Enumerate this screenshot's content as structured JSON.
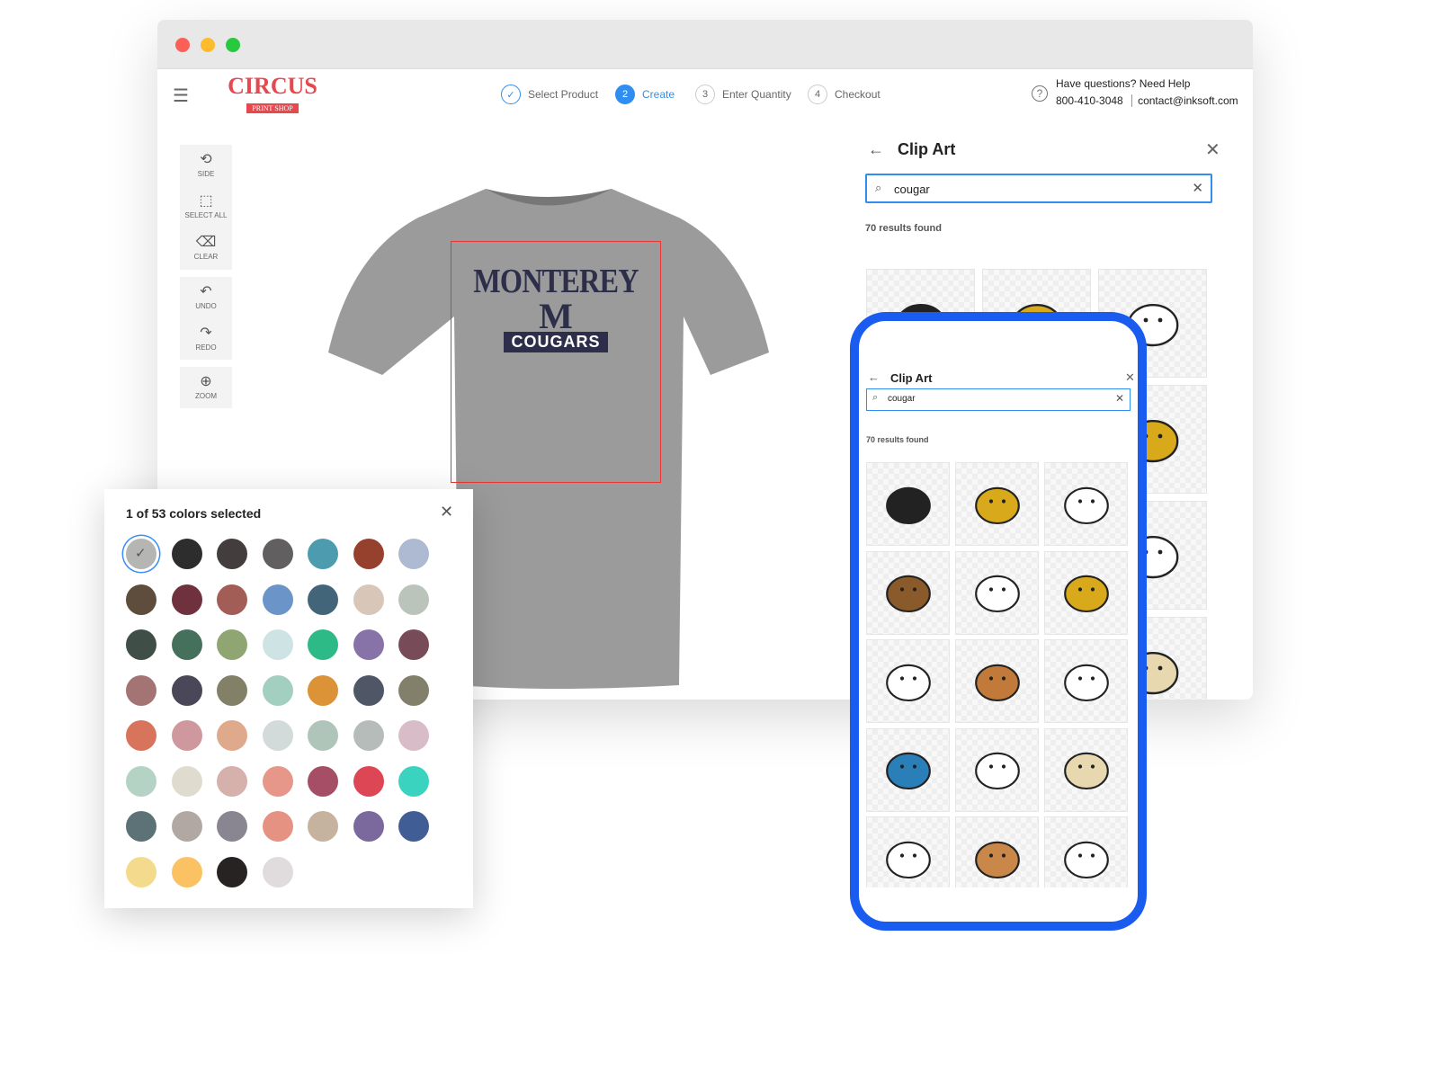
{
  "header": {
    "logo_main": "CIRCUS",
    "logo_sub": "PRINT SHOP",
    "help_title": "Have questions? Need Help",
    "phone": "800-410-3048",
    "email": "contact@inksoft.com"
  },
  "steps": [
    {
      "num": "✓",
      "label": "Select Product",
      "state": "done"
    },
    {
      "num": "2",
      "label": "Create",
      "state": "active"
    },
    {
      "num": "3",
      "label": "Enter Quantity",
      "state": "todo"
    },
    {
      "num": "4",
      "label": "Checkout",
      "state": "todo"
    }
  ],
  "tools": [
    {
      "icon": "rotate-icon",
      "glyph": "⟲",
      "label": "SIDE"
    },
    {
      "icon": "select-all-icon",
      "glyph": "⬚",
      "label": "SELECT ALL"
    },
    {
      "icon": "clear-icon",
      "glyph": "⌫",
      "label": "CLEAR"
    },
    {
      "icon": "undo-icon",
      "glyph": "↶",
      "label": "UNDO"
    },
    {
      "icon": "redo-icon",
      "glyph": "↷",
      "label": "REDO"
    },
    {
      "icon": "zoom-icon",
      "glyph": "⊕",
      "label": "ZOOM"
    }
  ],
  "design": {
    "line1": "MONTEREY",
    "line2": "M",
    "line3": "COUGARS"
  },
  "clipart": {
    "title": "Clip Art",
    "search_value": "cougar",
    "results": "70 results found"
  },
  "colors_panel": {
    "title": "1 of 53 colors selected",
    "selected_index": 0,
    "swatches": [
      "#b5b5b3",
      "#2d2d2d",
      "#433d3e",
      "#625f60",
      "#4c9bae",
      "#96412e",
      "#aebad2",
      "#5e4c3c",
      "#6e313d",
      "#a25d56",
      "#6b95c8",
      "#436579",
      "#d8c6b8",
      "#bac4bb",
      "#3f4f48",
      "#45705b",
      "#90a672",
      "#cde3e4",
      "#2dba87",
      "#8873a8",
      "#784b58",
      "#a47475",
      "#4a4858",
      "#838068",
      "#a2cfc0",
      "#dc9236",
      "#4f5665",
      "#827f6b",
      "#d8735c",
      "#cf979e",
      "#dfa98c",
      "#d3dbda",
      "#b0c5ba",
      "#b6bcba",
      "#d8bcc8",
      "#b4d3c4",
      "#dfdccf",
      "#d6b0aa",
      "#e6978a",
      "#a64e66",
      "#dd4655",
      "#3ad3c0",
      "#5c7276",
      "#b2a8a3",
      "#898692",
      "#e69283",
      "#c5b39f",
      "#7b689d",
      "#415d95",
      "#f3da8c",
      "#fbc263",
      "#272323",
      "#e0dcdd"
    ]
  },
  "accent": "#1a5cf0"
}
